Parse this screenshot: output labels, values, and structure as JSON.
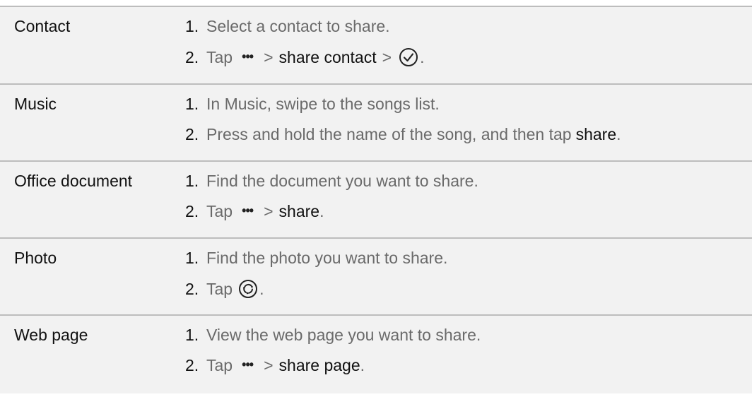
{
  "rows": [
    {
      "type": "Contact",
      "step1": {
        "num": "1.",
        "text": "Select a contact to share."
      },
      "step2": {
        "num": "2.",
        "pre": "Tap",
        "icon": "more-dots-icon",
        "gt1": ">",
        "kw": "share contact",
        "gt2": ">",
        "icon2": "check-circle-icon",
        "post": "."
      }
    },
    {
      "type": "Music",
      "step1": {
        "num": "1.",
        "text": "In Music, swipe to the songs list."
      },
      "step2": {
        "num": "2.",
        "pre": "Press and hold the name of the song, and then tap",
        "kw": "share",
        "post": "."
      }
    },
    {
      "type": "Office document",
      "step1": {
        "num": "1.",
        "text": "Find the document you want to share."
      },
      "step2": {
        "num": "2.",
        "pre": "Tap",
        "icon": "more-dots-icon",
        "gt1": ">",
        "kw": "share",
        "post": "."
      }
    },
    {
      "type": "Photo",
      "step1": {
        "num": "1.",
        "text": "Find the photo you want to share."
      },
      "step2": {
        "num": "2.",
        "pre": "Tap",
        "icon": "share-circle-icon",
        "post": "."
      }
    },
    {
      "type": "Web page",
      "step1": {
        "num": "1.",
        "text": "View the web page you want to share."
      },
      "step2": {
        "num": "2.",
        "pre": "Tap",
        "icon": "more-dots-icon",
        "gt1": ">",
        "kw": "share page",
        "post": "."
      }
    }
  ]
}
